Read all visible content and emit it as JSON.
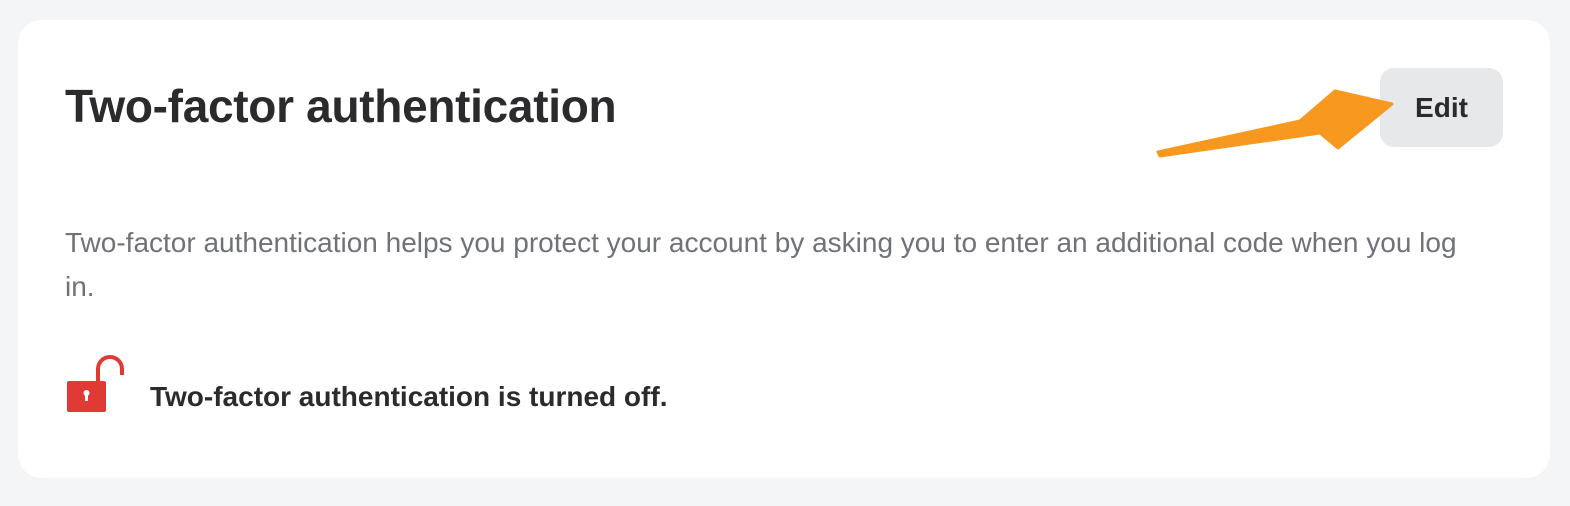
{
  "section": {
    "title": "Two-factor authentication",
    "edit_label": "Edit",
    "description": "Two-factor authentication helps you protect your account by asking you to enter an additional code when you log in.",
    "status_text": "Two-factor authentication is turned off.",
    "status_icon": "unlocked-padlock-icon"
  },
  "annotation": {
    "type": "arrow",
    "points_to": "edit-button",
    "color": "#f7981f"
  },
  "colors": {
    "background": "#f4f5f7",
    "card": "#ffffff",
    "text_primary": "#2b2b2e",
    "text_secondary": "#6f7278",
    "button_bg": "#e7e8ea",
    "lock_red": "#e03a35"
  }
}
